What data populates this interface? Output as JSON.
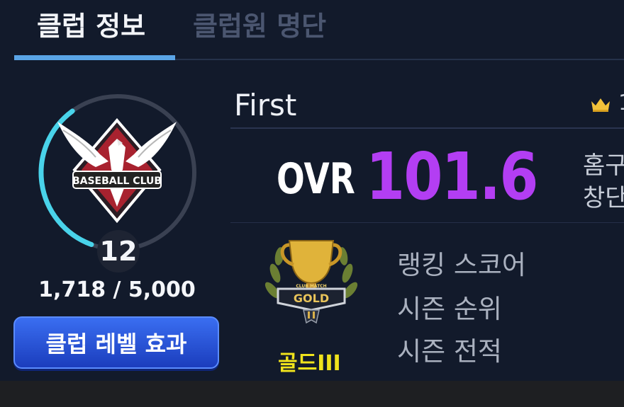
{
  "tabs": [
    {
      "label": "클럽 정보",
      "active": true
    },
    {
      "label": "클럽원 명단",
      "active": false
    }
  ],
  "club": {
    "logo_text": "BASEBALL CLUB",
    "level": "12",
    "exp": "1,718 / 5,000",
    "exp_progress": 0.3436,
    "level_effect_button": "클럽 레벨 효과",
    "name": "First",
    "ovr_label": "OVR",
    "ovr_value": "101.6"
  },
  "tier": {
    "emblem_text": "GOLD",
    "emblem_subtext": "CLUB MATCH",
    "label": "골드III"
  },
  "stats": {
    "labels": [
      "랭킹 스코어",
      "시즌 순위",
      "시즌 전적"
    ]
  },
  "side_info": {
    "line1": "홈구",
    "line2": "창단",
    "rank_number": "1"
  },
  "colors": {
    "background": "#121a2b",
    "accent_tab": "#5aa4e6",
    "ovr": "#b33ef3",
    "tier": "#f0e31c",
    "button": "#2f5fe0",
    "ring_progress": "#49d3ea"
  },
  "icons": [
    "crown-icon",
    "club-logo-icon",
    "gold-trophy-icon"
  ]
}
